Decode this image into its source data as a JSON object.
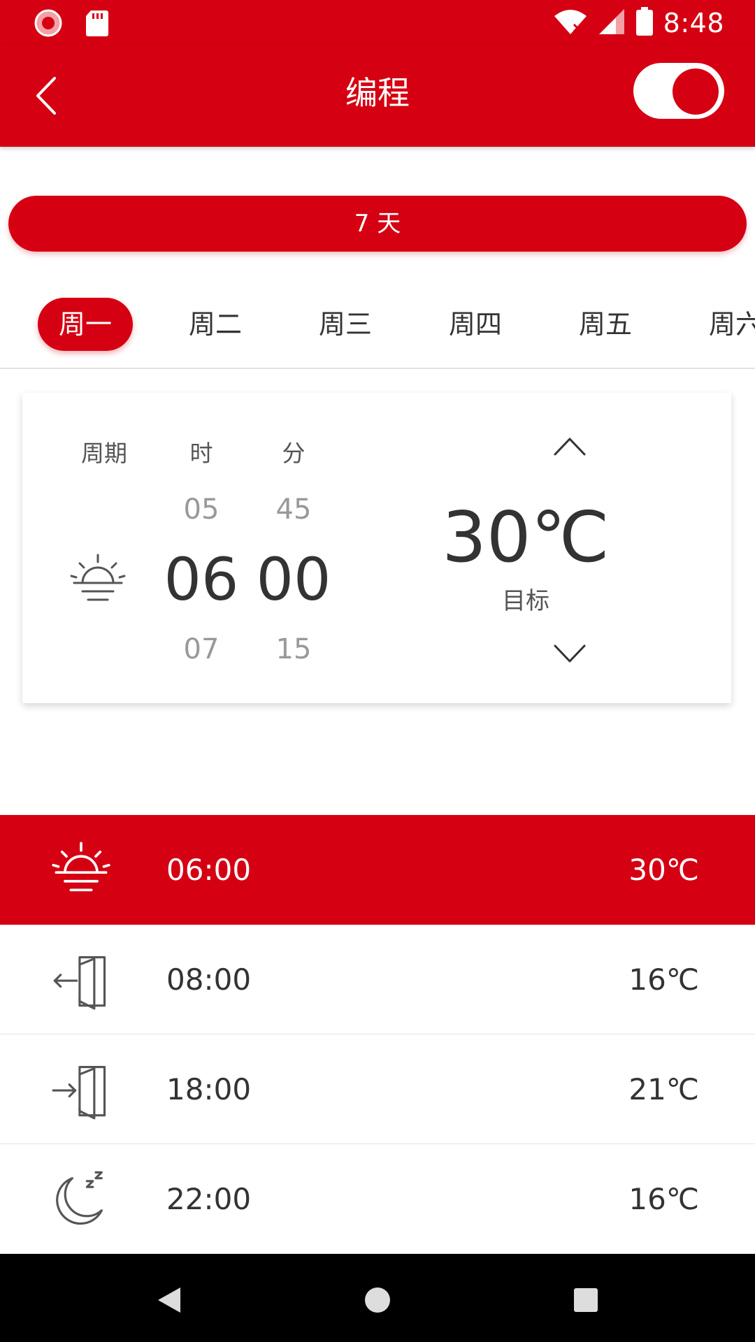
{
  "status_bar": {
    "time": "8:48",
    "icons": [
      "app-notification-icon",
      "sd-card-icon",
      "wifi-icon",
      "cell-signal-icon",
      "battery-icon"
    ]
  },
  "app_bar": {
    "title": "编程",
    "back_icon": "chevron-left-icon",
    "toggle_on": true
  },
  "period": {
    "label": "7 天"
  },
  "day_tabs": [
    {
      "label": "周一",
      "active": true
    },
    {
      "label": "周二",
      "active": false
    },
    {
      "label": "周三",
      "active": false
    },
    {
      "label": "周四",
      "active": false
    },
    {
      "label": "周五",
      "active": false
    },
    {
      "label": "周六",
      "active": false
    }
  ],
  "editor": {
    "headers": {
      "period": "周期",
      "hour": "时",
      "minute": "分"
    },
    "period_icon": "sunrise-icon",
    "hour": {
      "prev": "05",
      "current": "06",
      "next": "07"
    },
    "minute": {
      "prev": "45",
      "current": "00",
      "next": "15"
    },
    "temp": {
      "value": "30℃",
      "label": "目标"
    },
    "up_icon": "chevron-up-icon",
    "down_icon": "chevron-down-icon"
  },
  "schedule": [
    {
      "icon": "sunrise-icon",
      "time": "06:00",
      "temp": "30℃",
      "active": true
    },
    {
      "icon": "leave-home-icon",
      "time": "08:00",
      "temp": "16℃",
      "active": false
    },
    {
      "icon": "return-home-icon",
      "time": "18:00",
      "temp": "21℃",
      "active": false
    },
    {
      "icon": "sleep-moon-icon",
      "time": "22:00",
      "temp": "16℃",
      "active": false
    }
  ],
  "nav_bar": {
    "icons": [
      "back-triangle-icon",
      "home-circle-icon",
      "recents-square-icon"
    ]
  },
  "colors": {
    "accent": "#D50012",
    "text": "#333333",
    "muted": "#999999",
    "divider": "#E3E3E3"
  }
}
